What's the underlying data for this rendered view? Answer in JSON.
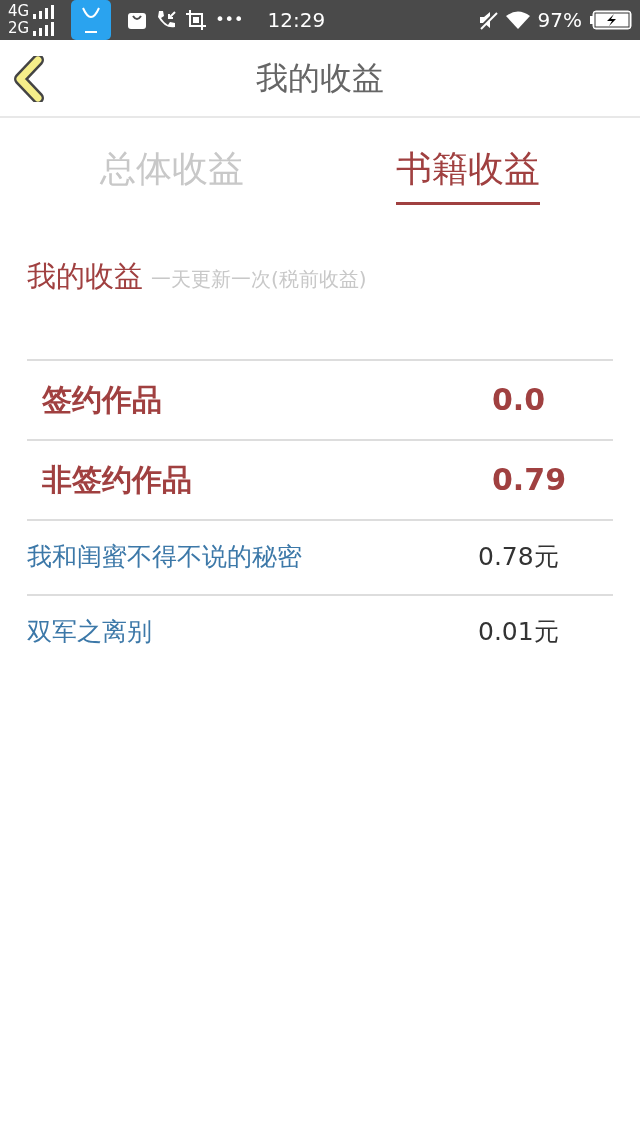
{
  "status_bar": {
    "networks": [
      "4G",
      "2G"
    ],
    "more": "•••",
    "time": "12:29",
    "battery": "97%"
  },
  "header": {
    "title": "我的收益"
  },
  "tabs": [
    {
      "label": "总体收益",
      "selected": false
    },
    {
      "label": "书籍收益",
      "selected": true
    }
  ],
  "section": {
    "title": "我的收益",
    "note": "一天更新一次(税前收益)"
  },
  "rows": [
    {
      "kind": "category",
      "name": "签约作品",
      "value": "0.0"
    },
    {
      "kind": "category",
      "name": "非签约作品",
      "value": "0.79"
    },
    {
      "kind": "book",
      "name": "我和闺蜜不得不说的秘密",
      "value": "0.78元"
    },
    {
      "kind": "book",
      "name": "双军之离别",
      "value": "0.01元"
    }
  ]
}
